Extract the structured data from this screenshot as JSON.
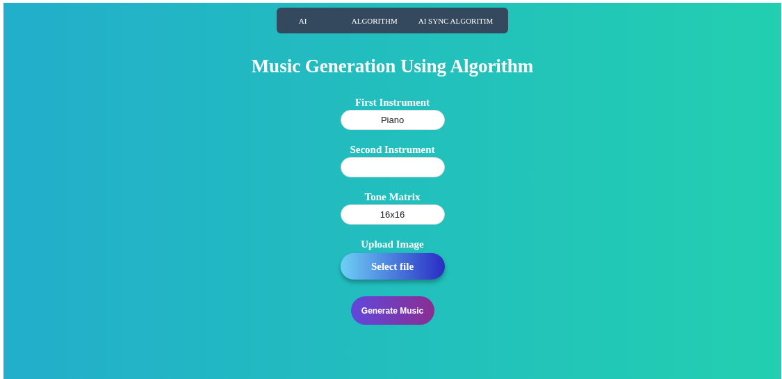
{
  "nav": {
    "items": [
      {
        "label": "AI"
      },
      {
        "label": "ALGORITHM"
      },
      {
        "label": "AI SYNC ALGORITIM"
      }
    ]
  },
  "title": "Music Generation Using Algorithm",
  "form": {
    "fields": [
      {
        "label": "First Instrument",
        "value": "Piano"
      },
      {
        "label": "Second Instrument"
      },
      {
        "label": "Tone Matrix",
        "value": "16x16"
      }
    ],
    "upload": {
      "label": "Upload Image",
      "button": "Select file"
    },
    "submit": "Generate Music"
  }
}
